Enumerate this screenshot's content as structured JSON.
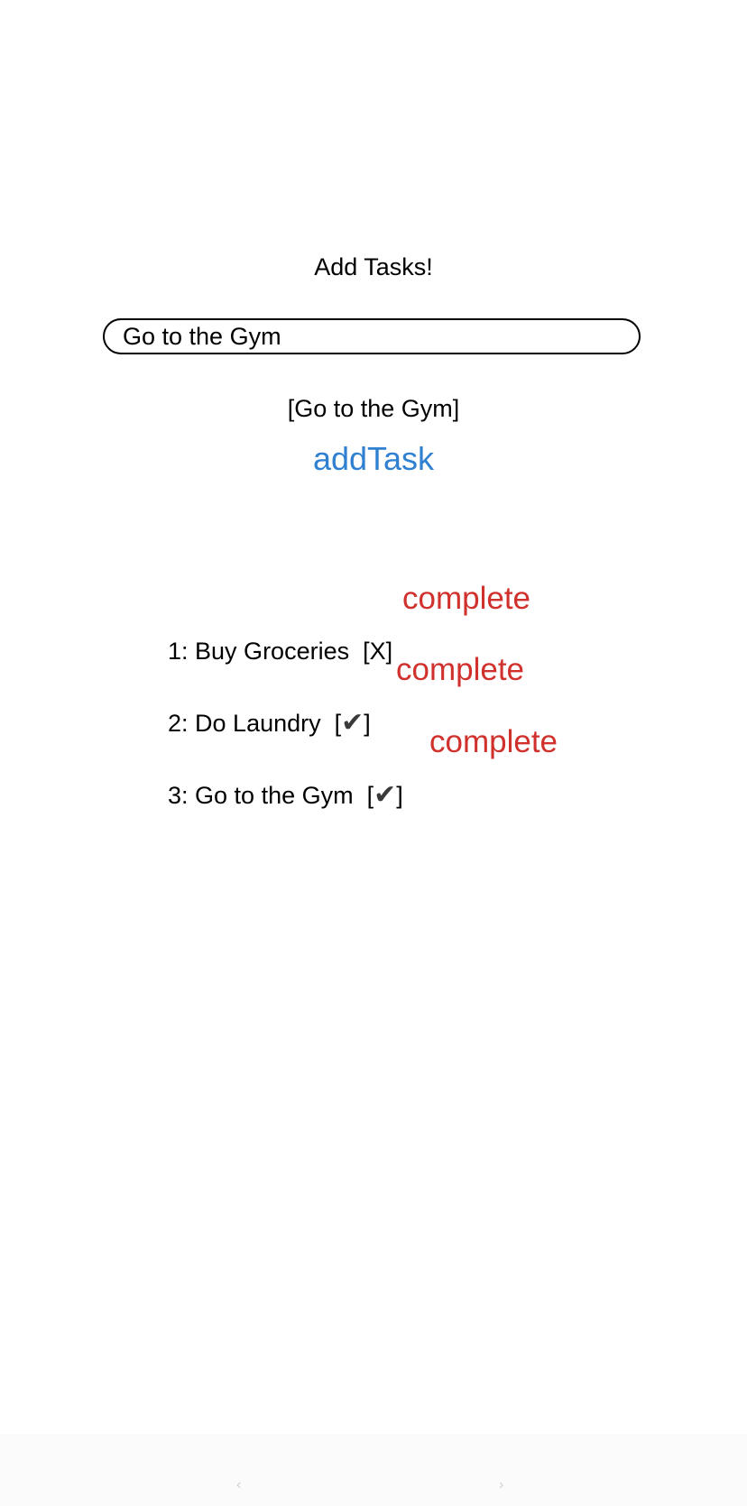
{
  "header": {
    "title": "Add Tasks!"
  },
  "task_input": {
    "value": "Go to the Gym",
    "placeholder": ""
  },
  "echo_text": "[Go to the Gym]",
  "add_button": {
    "label": "addTask"
  },
  "tasks": [
    {
      "label": "1: Buy Groceries  [X]",
      "status": "X",
      "complete_label": "complete"
    },
    {
      "label": "2: Do Laundry  [",
      "status": "✔",
      "suffix": "]",
      "complete_label": "complete"
    },
    {
      "label": "3: Go to the Gym  [",
      "status": "✔",
      "suffix": "]",
      "complete_label": "complete"
    }
  ],
  "home_bar": {
    "left": "‹",
    "right": "›"
  },
  "colors": {
    "accent": "#2f80d1",
    "complete": "#d0312d",
    "text": "#000000"
  }
}
